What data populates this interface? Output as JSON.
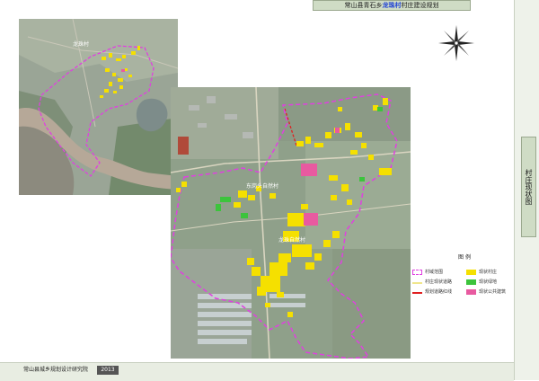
{
  "header": {
    "title_prefix": "常山县青石乡",
    "title_highlight": "龙珠村",
    "title_suffix": "村庄建设规划"
  },
  "side": {
    "label": "村庄现状图"
  },
  "footer": {
    "text": "常山县城乡规划设计研究院",
    "badge": "2013"
  },
  "maps": {
    "inset_label": "龙珠村",
    "main_label_1": "东岗头自然村",
    "main_label_2": "龙珠自然村"
  },
  "legend": {
    "title": "图 例",
    "items": [
      {
        "label": "村域范围",
        "color": "#e040e0",
        "style": "dashed-box"
      },
      {
        "label": "现状村庄",
        "color": "#f5e000",
        "style": "fill"
      },
      {
        "label": "村庄现状道路",
        "color": "#f0e68c",
        "style": "line"
      },
      {
        "label": "现状绿地",
        "color": "#3cc43c",
        "style": "fill"
      },
      {
        "label": "规划道路红线",
        "color": "#e02020",
        "style": "dashed-line"
      },
      {
        "label": "现状公共建筑",
        "color": "#e85aa0",
        "style": "fill"
      }
    ]
  },
  "colors": {
    "aerial_base": "#8fa08a",
    "settlement": "#f5e000",
    "boundary": "#e040e0",
    "public_building": "#e85aa0",
    "green": "#3cc43c"
  }
}
